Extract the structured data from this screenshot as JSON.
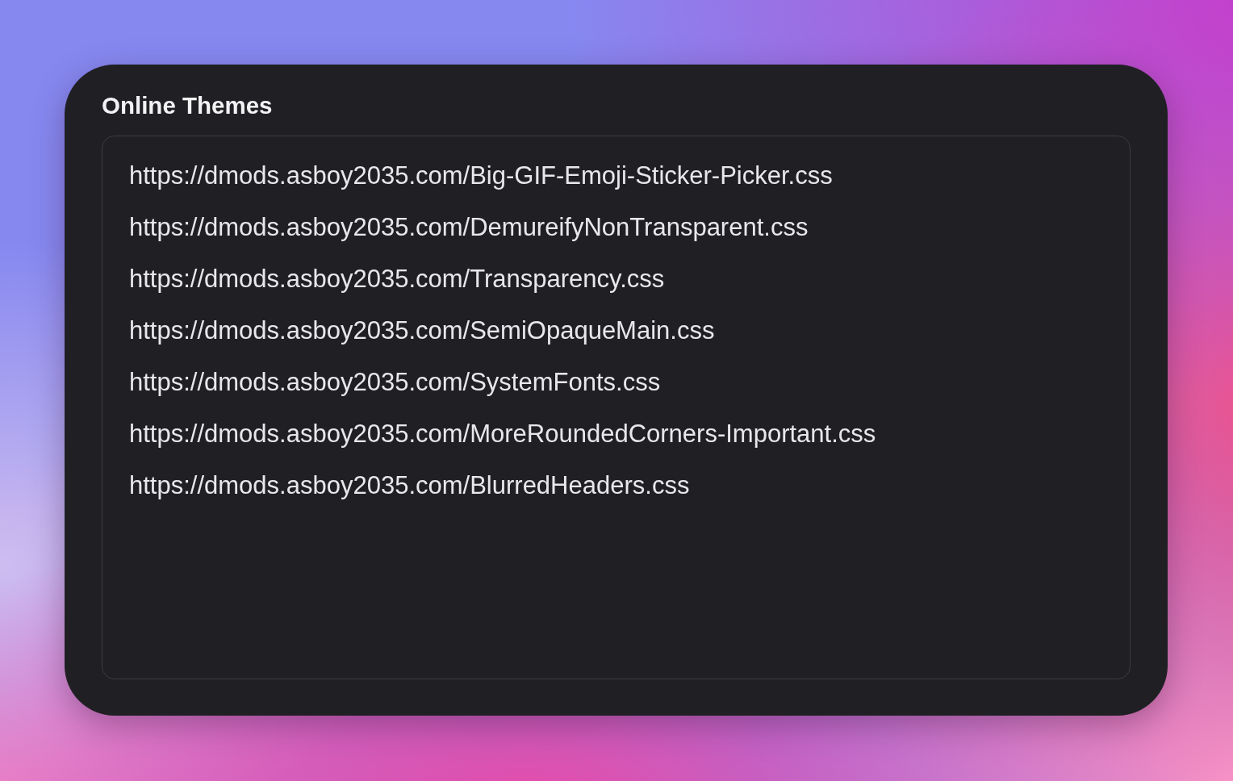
{
  "panel": {
    "title": "Online Themes",
    "text_area": {
      "lines": [
        "https://dmods.asboy2035.com/Big-GIF-Emoji-Sticker-Picker.css",
        "https://dmods.asboy2035.com/DemureifyNonTransparent.css",
        "https://dmods.asboy2035.com/Transparency.css",
        "https://dmods.asboy2035.com/SemiOpaqueMain.css",
        "https://dmods.asboy2035.com/SystemFonts.css",
        "https://dmods.asboy2035.com/MoreRoundedCorners-Important.css",
        "https://dmods.asboy2035.com/BlurredHeaders.css"
      ]
    }
  }
}
